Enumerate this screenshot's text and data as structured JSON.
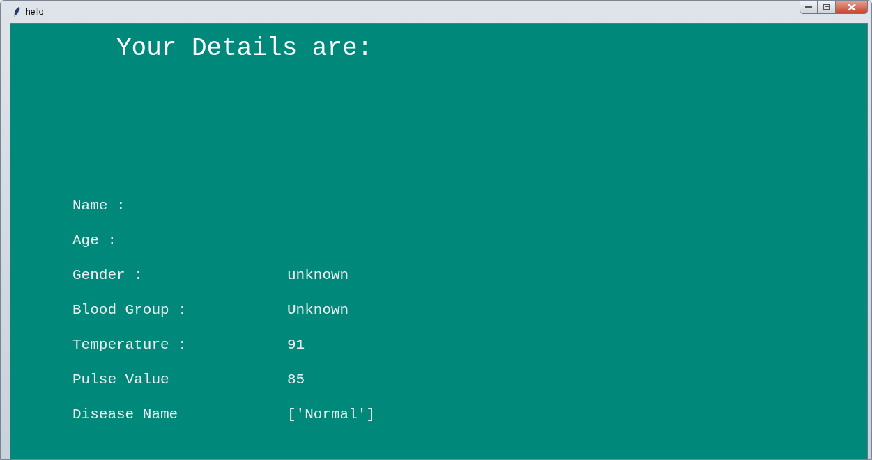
{
  "window": {
    "title": "hello"
  },
  "heading": "Your Details are:",
  "rows": [
    {
      "label": "Name :"
    },
    {
      "label": "Age :"
    },
    {
      "label": "Gender :",
      "value": "unknown"
    },
    {
      "label": "Blood Group :",
      "value": "Unknown"
    },
    {
      "label": "Temperature :",
      "value": "91"
    },
    {
      "label": "Pulse Value",
      "value": "85"
    },
    {
      "label": "Disease Name",
      "value": "['Normal']"
    }
  ]
}
